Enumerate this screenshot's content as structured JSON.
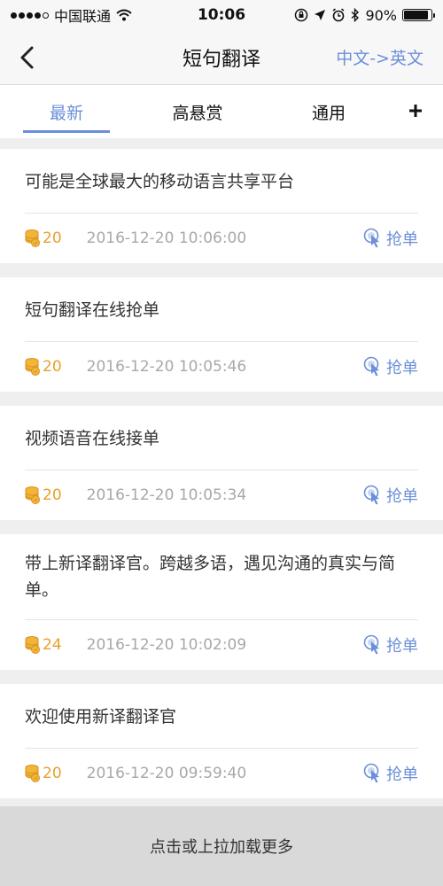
{
  "status_bar": {
    "carrier": "中国联通",
    "time": "10:06",
    "battery_text": "90%",
    "battery_level": 0.9
  },
  "nav": {
    "title": "短句翻译",
    "lang_switch": "中文->英文"
  },
  "tabs": [
    {
      "label": "最新"
    },
    {
      "label": "高悬赏"
    },
    {
      "label": "通用"
    }
  ],
  "colors": {
    "accent": "#6b8fd8",
    "coin": "#e8a02a",
    "meta": "#a8a8a8"
  },
  "items": [
    {
      "title": "可能是全球最大的移动语言共享平台",
      "reward": "20",
      "time": "2016-12-20 10:06:00",
      "action": "抢单"
    },
    {
      "title": "短句翻译在线抢单",
      "reward": "20",
      "time": "2016-12-20 10:05:46",
      "action": "抢单"
    },
    {
      "title": "视频语音在线接单",
      "reward": "20",
      "time": "2016-12-20 10:05:34",
      "action": "抢单"
    },
    {
      "title": "带上新译翻译官。跨越多语，遇见沟通的真实与简单。",
      "reward": "24",
      "time": "2016-12-20 10:02:09",
      "action": "抢单"
    },
    {
      "title": "欢迎使用新译翻译官",
      "reward": "20",
      "time": "2016-12-20 09:59:40",
      "action": "抢单"
    }
  ],
  "load_more": "点击或上拉加载更多"
}
